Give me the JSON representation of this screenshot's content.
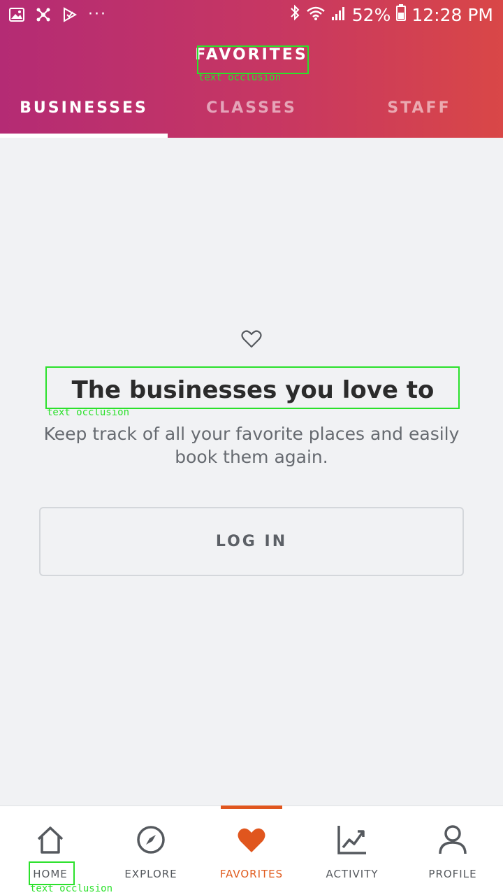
{
  "status_bar": {
    "battery": "52%",
    "time": "12:28 PM",
    "more": "···"
  },
  "header": {
    "title": "FAVORITES",
    "occlusion_label": "text occlusion"
  },
  "tabs": [
    {
      "label": "BUSINESSES",
      "active": true
    },
    {
      "label": "CLASSES",
      "active": false
    },
    {
      "label": "STAFF",
      "active": false
    }
  ],
  "empty_state": {
    "icon": "heart-outline-icon",
    "title": "The businesses you love to love",
    "occlusion_label": "text occlusion",
    "subtitle": "Keep track of all your favorite places and easily book them again."
  },
  "login_button": {
    "label": "LOG IN"
  },
  "bottom_nav": {
    "items": [
      {
        "label": "HOME",
        "icon": "home-icon"
      },
      {
        "label": "EXPLORE",
        "icon": "compass-icon"
      },
      {
        "label": "FAVORITES",
        "icon": "heart-icon",
        "active": true
      },
      {
        "label": "ACTIVITY",
        "icon": "chart-icon"
      },
      {
        "label": "PROFILE",
        "icon": "person-icon"
      }
    ],
    "occlusion_label": "text occlusion"
  },
  "colors": {
    "header_gradient_start": "#b42b74",
    "header_gradient_end": "#d94747",
    "accent": "#e05a1c",
    "background": "#f1f2f4"
  }
}
